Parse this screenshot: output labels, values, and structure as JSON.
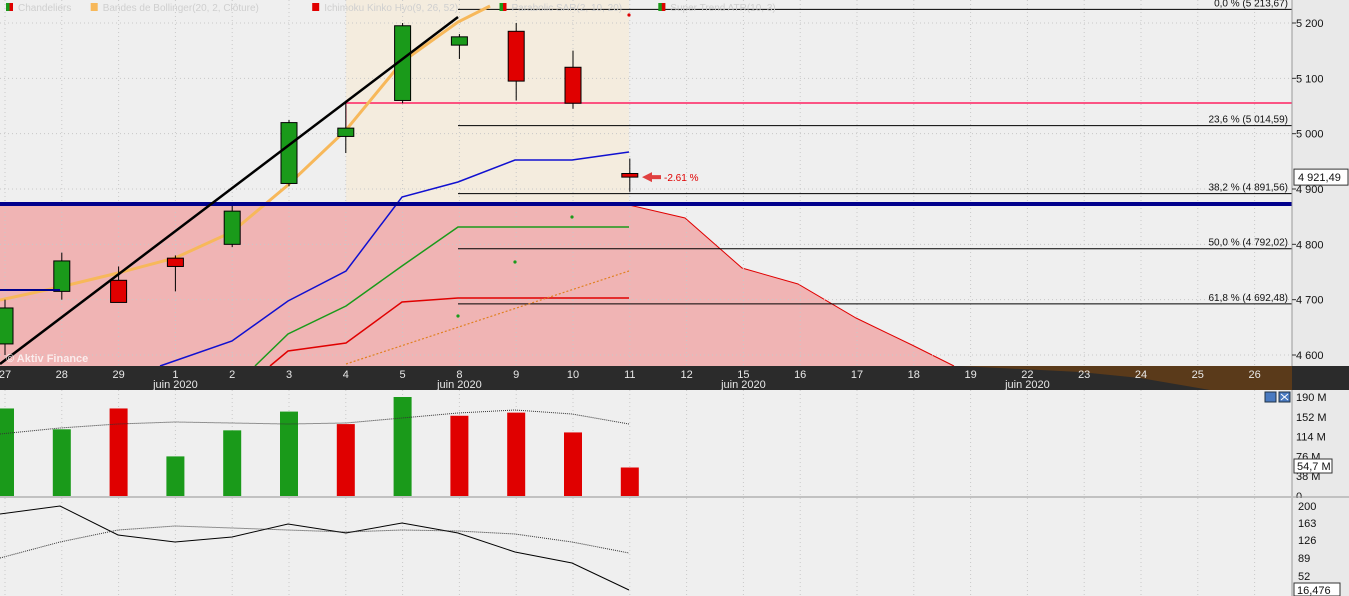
{
  "legend": {
    "items": [
      {
        "label": "Chandeliers",
        "color": "#1a9a1a",
        "color2": "#e00000"
      },
      {
        "label": "Bandes de Bollinger(20, 2, Clôture)",
        "color": "#f7b85a"
      },
      {
        "label": "Ichimoku Kinko Hyo(9, 26, 52)",
        "color": "#e00000"
      },
      {
        "label": "Parabolic SAR(2, 10, 20)",
        "color": "#1a9a1a",
        "color2": "#e00000"
      },
      {
        "label": "Super Trend ATR(10, 3)",
        "color": "#1a9a1a",
        "color2": "#e00000"
      }
    ]
  },
  "watermark": "© Aktiv Finance",
  "price_axis": {
    "ticks": [
      "5 200",
      "5 100",
      "5 000",
      "4 900",
      "4 800",
      "4 700",
      "4 600"
    ],
    "tick_values": [
      5200,
      5100,
      5000,
      4900,
      4800,
      4700,
      4600
    ],
    "current_price_label": "4 921,49"
  },
  "fib": [
    {
      "label": "0,0 % (5 213,67)",
      "value": 5213.67
    },
    {
      "label": "23,6 % (5 014,59)",
      "value": 5014.59
    },
    {
      "label": "38,2 % (4 891,56)",
      "value": 4891.56
    },
    {
      "label": "50,0 % (4 792,02)",
      "value": 4792.02
    },
    {
      "label": "61,8 % (4 692,48)",
      "value": 4692.48
    }
  ],
  "change_label": "-2.61 %",
  "date_axis": {
    "days": [
      "27",
      "28",
      "29",
      "1",
      "2",
      "3",
      "4",
      "5",
      "8",
      "9",
      "10",
      "11",
      "12",
      "15",
      "16",
      "17",
      "18",
      "19",
      "22",
      "23",
      "24",
      "25",
      "26"
    ],
    "months": [
      {
        "label": "juin 2020",
        "day": "1"
      },
      {
        "label": "juin 2020",
        "day": "8"
      },
      {
        "label": "juin 2020",
        "day": "15"
      },
      {
        "label": "juin 2020",
        "day": "22"
      }
    ]
  },
  "volume_axis": {
    "ticks": [
      "190 M",
      "152 M",
      "114 M",
      "76 M",
      "38 M",
      "0"
    ],
    "current_label": "54,7 M"
  },
  "osc_axis": {
    "ticks": [
      "200",
      "163",
      "126",
      "89",
      "52"
    ],
    "current_label": "16,476"
  },
  "colors": {
    "up": "#1a9a1a",
    "down": "#e00000",
    "bollinger": "#f7b85a",
    "kijun": "#1010d0",
    "supertrend": "#00008c",
    "trend_line": "#000000",
    "cloud": "#f0b4b4"
  },
  "chart_data": [
    {
      "type": "candlestick",
      "title": "",
      "categories": [
        "27",
        "28",
        "29",
        "1",
        "2",
        "3",
        "4",
        "5",
        "8",
        "9",
        "10",
        "11"
      ],
      "ohlc": [
        {
          "open": 4620,
          "high": 4700,
          "low": 4600,
          "close": 4685
        },
        {
          "open": 4715,
          "high": 4785,
          "low": 4700,
          "close": 4770
        },
        {
          "open": 4735,
          "high": 4760,
          "low": 4695,
          "close": 4695
        },
        {
          "open": 4775,
          "high": 4780,
          "low": 4715,
          "close": 4760
        },
        {
          "open": 4800,
          "high": 4875,
          "low": 4795,
          "close": 4860
        },
        {
          "open": 4910,
          "high": 5025,
          "low": 4905,
          "close": 5020
        },
        {
          "open": 4995,
          "high": 5055,
          "low": 4965,
          "close": 5010
        },
        {
          "open": 5060,
          "high": 5200,
          "low": 5055,
          "close": 5195
        },
        {
          "open": 5160,
          "high": 5180,
          "low": 5135,
          "close": 5175
        },
        {
          "open": 5185,
          "high": 5200,
          "low": 5060,
          "close": 5095
        },
        {
          "open": 5120,
          "high": 5150,
          "low": 5045,
          "close": 5055
        },
        {
          "open": 4928,
          "high": 4955,
          "low": 4895,
          "close": 4921.49
        }
      ],
      "ylim": [
        4580,
        5230
      ]
    },
    {
      "type": "bar",
      "title": "",
      "categories": [
        "27",
        "28",
        "29",
        "1",
        "2",
        "3",
        "4",
        "5",
        "8",
        "9",
        "10",
        "11"
      ],
      "values": [
        168,
        128,
        168,
        76,
        126,
        162,
        138,
        190,
        154,
        160,
        122,
        54.7
      ],
      "colors": [
        "up",
        "up",
        "down",
        "up",
        "up",
        "up",
        "down",
        "up",
        "down",
        "down",
        "down",
        "down"
      ],
      "ylim": [
        0,
        190
      ]
    },
    {
      "type": "line",
      "title": "",
      "categories": [
        "27",
        "28",
        "29",
        "1",
        "2",
        "3",
        "4",
        "5",
        "8",
        "9",
        "10",
        "11"
      ],
      "ylim": [
        10,
        210
      ]
    }
  ]
}
